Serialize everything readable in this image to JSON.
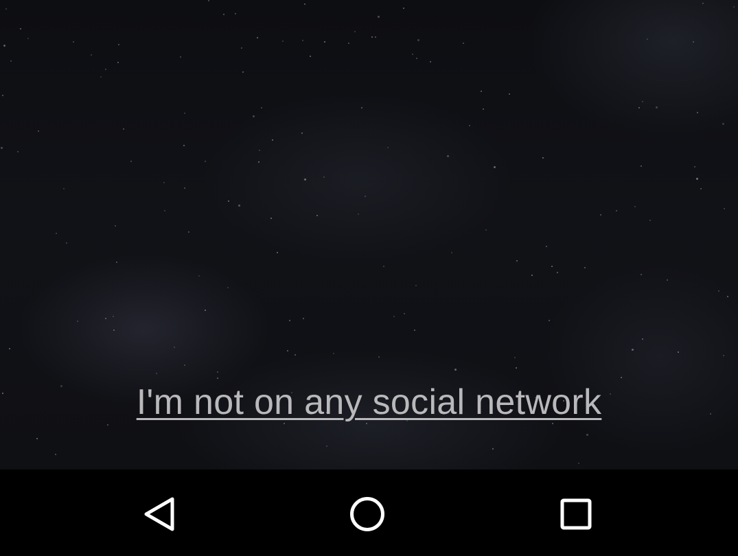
{
  "main": {
    "link_text": "I'm not on any social network"
  },
  "nav_bar": {
    "buttons": [
      {
        "name": "back",
        "icon": "back-triangle-icon"
      },
      {
        "name": "home",
        "icon": "home-circle-icon"
      },
      {
        "name": "recents",
        "icon": "recents-square-icon"
      }
    ]
  },
  "colors": {
    "link_text": "#b9b9bc",
    "nav_icon": "#ffffff",
    "nav_bg": "#000000"
  }
}
